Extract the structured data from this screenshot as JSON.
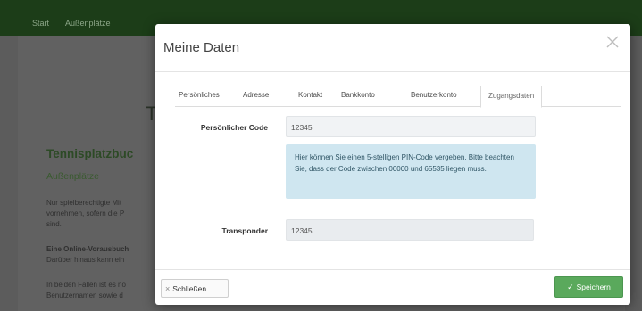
{
  "nav": {
    "items": [
      "Start",
      "Außenplätze"
    ]
  },
  "background": {
    "heading_letter": "T",
    "title": "Tennisplatzbuc",
    "subtitle": "Außenplätze",
    "paragraphs": [
      "Nur spielberechtigte Mit",
      "vornehmen, sofern die P",
      "sind.",
      "Eine Online-Vorausbuch",
      "Darüber hinaus kann ein",
      "In beiden Fällen ist es no",
      "Benutzernamen sowie d"
    ]
  },
  "modal": {
    "title": "Meine Daten",
    "close_icon": "close-icon",
    "tabs": [
      {
        "label": "Persönliches",
        "active": false
      },
      {
        "label": "Adresse",
        "active": false
      },
      {
        "label": "Kontakt",
        "active": false
      },
      {
        "label": "Bankkonto",
        "active": false
      },
      {
        "label": "Benutzerkonto",
        "active": false
      },
      {
        "label": "Zugangsdaten",
        "active": true
      }
    ],
    "fields": {
      "personal_code": {
        "label": "Persönlicher Code",
        "value": "12345"
      },
      "transponder": {
        "label": "Transponder",
        "value": "12345"
      }
    },
    "info": "Hier können Sie einen 5-stelligen PIN-Code vergeben. Bitte beachten Sie, dass der Code zwischen 00000 und 65535 liegen muss.",
    "buttons": {
      "close": {
        "icon": "×",
        "label": "Schließen"
      },
      "save": {
        "icon": "✓",
        "label": "Speichern"
      }
    }
  },
  "colors": {
    "navbar": "#1c3d18",
    "save_button": "#5aa95c",
    "info_box": "#cfe6f0",
    "info_text": "#2f5565"
  }
}
